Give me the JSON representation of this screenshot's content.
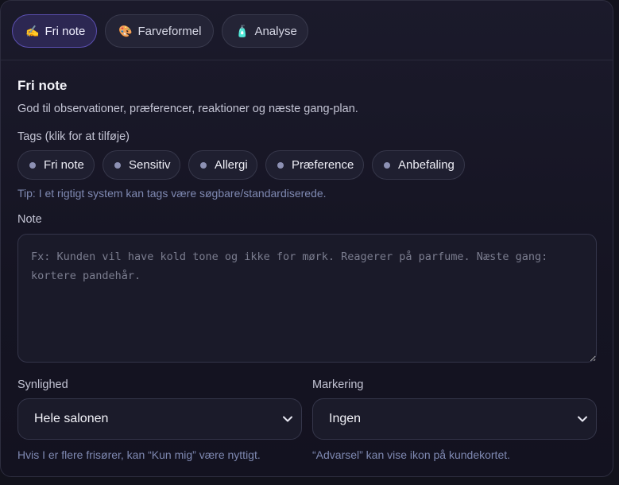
{
  "tabs": [
    {
      "label": "Fri note",
      "icon": "writing-hand-icon",
      "glyph": "✍️",
      "active": true
    },
    {
      "label": "Farveformel",
      "icon": "palette-icon",
      "glyph": "🎨",
      "active": false
    },
    {
      "label": "Analyse",
      "icon": "bottle-icon",
      "glyph": "🧴",
      "active": false
    }
  ],
  "section": {
    "title": "Fri note",
    "subtitle": "God til observationer, præferencer, reaktioner og næste gang-plan."
  },
  "tags": {
    "label": "Tags (klik for at tilføje)",
    "items": [
      "Fri note",
      "Sensitiv",
      "Allergi",
      "Præference",
      "Anbefaling"
    ],
    "tip": "Tip: I et rigtigt system kan tags være søgbare/standardiserede."
  },
  "note": {
    "label": "Note",
    "value": "",
    "placeholder": "Fx: Kunden vil have kold tone og ikke for mørk. Reagerer på parfume. Næste gang: kortere pandehår."
  },
  "visibility": {
    "label": "Synlighed",
    "selected": "Hele salonen",
    "hint": "Hvis I er flere frisører, kan “Kun mig” være nyttigt."
  },
  "marking": {
    "label": "Markering",
    "selected": "Ingen",
    "hint": "“Advarsel” kan vise ikon på kundekortet."
  },
  "colors": {
    "accent": "#5b4fb0",
    "tip_text": "#7f89b2",
    "tag_dot": "#8d91b4"
  }
}
